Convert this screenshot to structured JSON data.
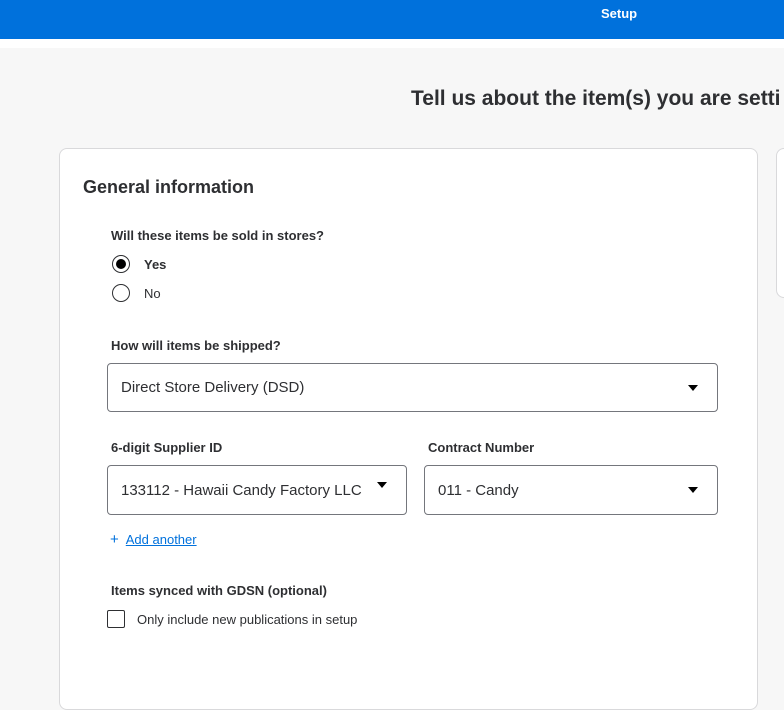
{
  "header": {
    "tab_label": "Setup",
    "brand_color": "#0071dc"
  },
  "page": {
    "title": "Tell us about the item(s) you are setti"
  },
  "general_info": {
    "title": "General information",
    "sold_in_stores": {
      "question": "Will these items be sold in stores?",
      "options": [
        {
          "label": "Yes",
          "selected": true
        },
        {
          "label": "No",
          "selected": false
        }
      ]
    },
    "shipping": {
      "question": "How will items be shipped?",
      "value": "Direct Store Delivery (DSD)"
    },
    "supplier": {
      "label": "6-digit Supplier ID",
      "value": "133112 - Hawaii Candy Factory LLC"
    },
    "contract": {
      "label": "Contract Number",
      "value": "011 - Candy"
    },
    "add_another": "Add another",
    "gdsn": {
      "label": "Items synced with GDSN (optional)",
      "checkbox_label": "Only include new publications in setup",
      "checked": false
    }
  },
  "icons": [
    "plus-icon",
    "chevron-down-icon",
    "radio-icon",
    "checkbox-icon"
  ]
}
